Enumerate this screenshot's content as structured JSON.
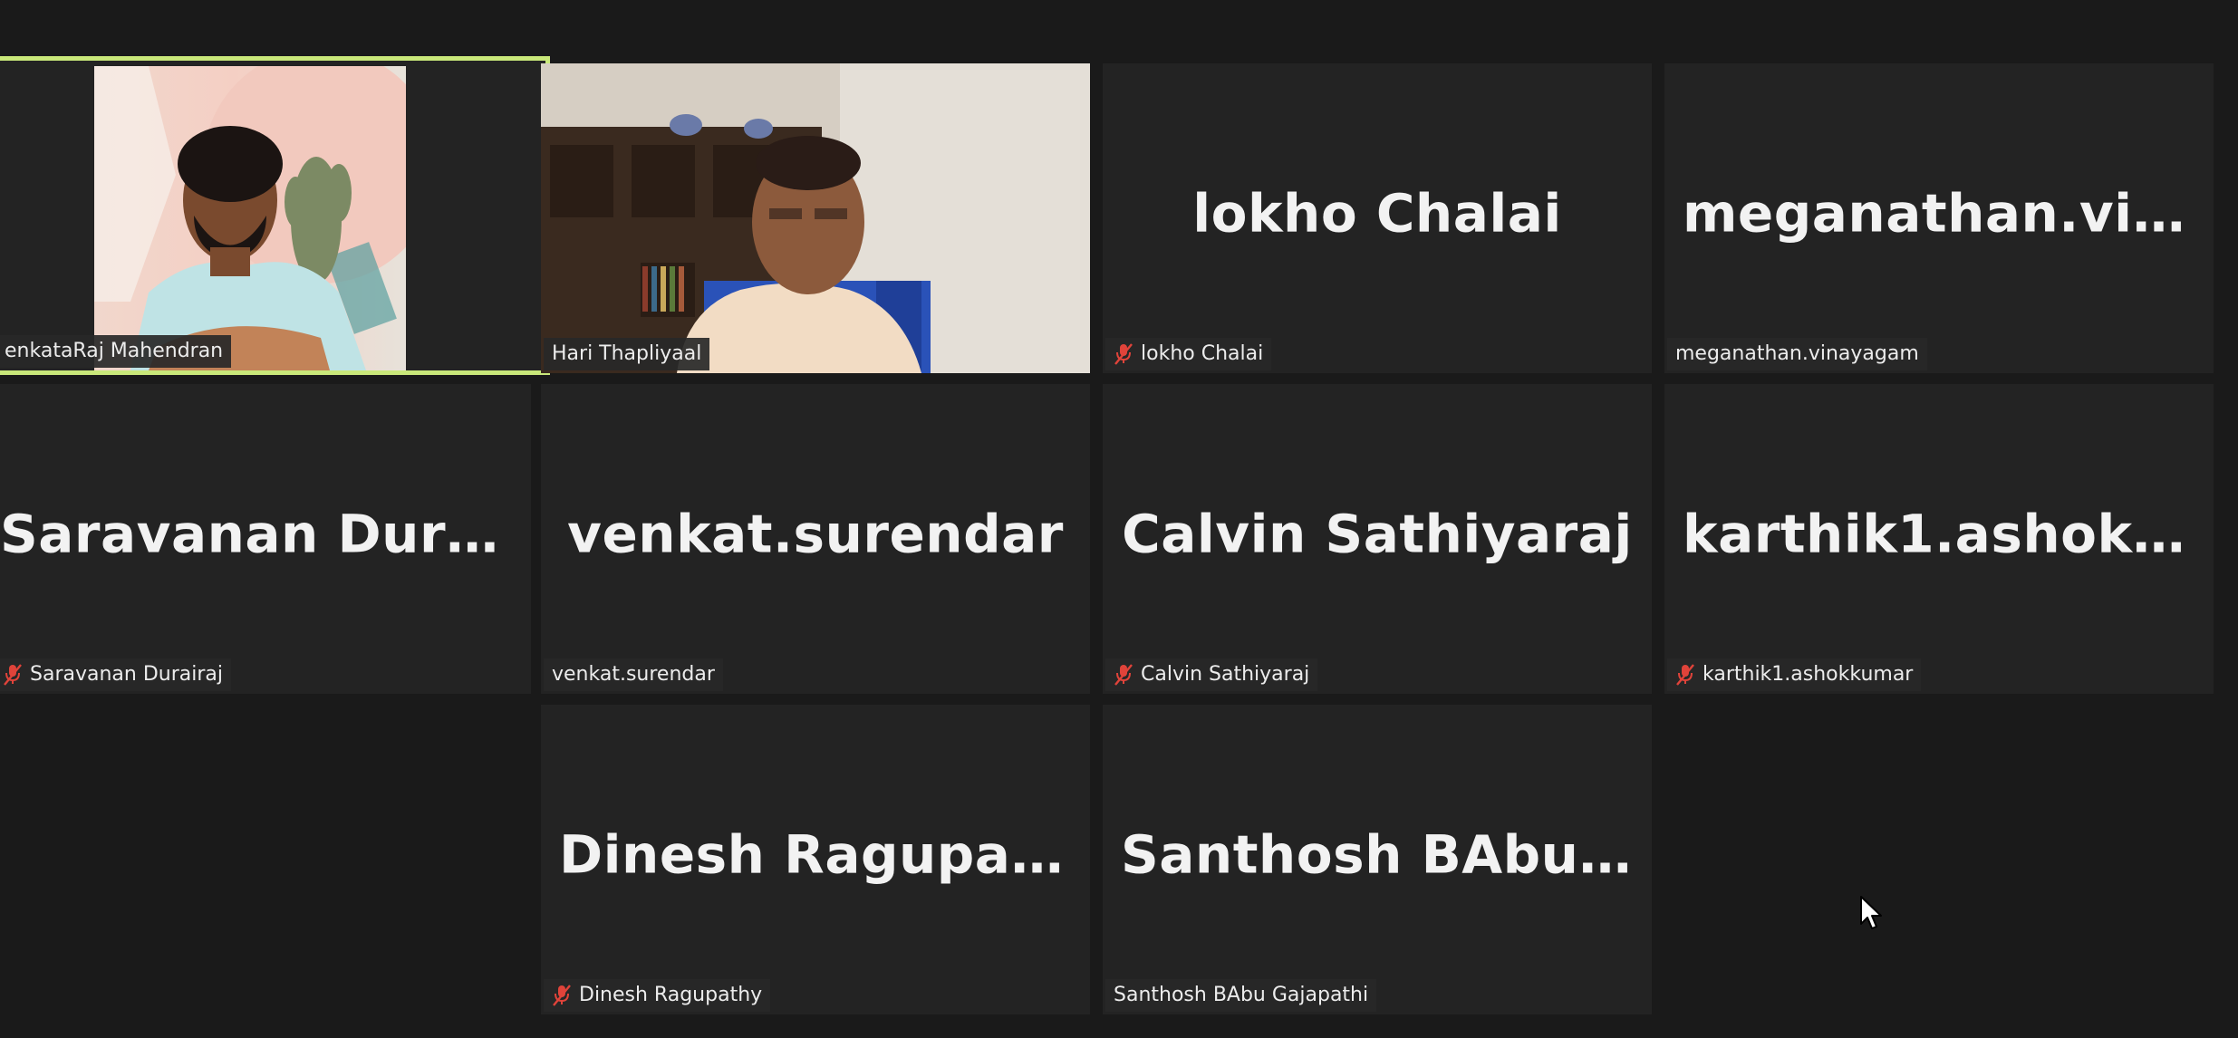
{
  "meeting": {
    "participants": [
      {
        "name": "VenkataRaj Mahendran",
        "label": "enkataRaj Mahendran",
        "video": true,
        "muted": false,
        "active_speaker": true
      },
      {
        "name": "Hari Thapliyaal",
        "label": "Hari Thapliyaal",
        "video": true,
        "muted": false,
        "active_speaker": false
      },
      {
        "name": "lokho Chalai",
        "label": "lokho Chalai",
        "big": "lokho Chalai",
        "video": false,
        "muted": true
      },
      {
        "name": "meganathan.vinayagam",
        "label": "meganathan.vinayagam",
        "big": "meganathan.vin...",
        "video": false,
        "muted": false
      },
      {
        "name": "Saravanan Durairaj",
        "label": "Saravanan Durairaj",
        "big": "Saravanan  Durai...",
        "video": false,
        "muted": true
      },
      {
        "name": "venkat.surendar",
        "label": "venkat.surendar",
        "big": "venkat.surendar",
        "video": false,
        "muted": false
      },
      {
        "name": "Calvin Sathiyaraj",
        "label": "Calvin Sathiyaraj",
        "big": "Calvin Sathiyaraj",
        "video": false,
        "muted": true
      },
      {
        "name": "karthik1.ashokkumar",
        "label": "karthik1.ashokkumar",
        "big": "karthik1.ashokk...",
        "video": false,
        "muted": true
      },
      {
        "name": "Dinesh Ragupathy",
        "label": "Dinesh Ragupathy",
        "big": "Dinesh Ragupathy",
        "video": false,
        "muted": true
      },
      {
        "name": "Santhosh BAbu Gajapathi",
        "label": "Santhosh BAbu Gajapathi",
        "big": "Santhosh  BAbu...",
        "video": false,
        "muted": false
      }
    ]
  },
  "colors": {
    "background": "#1a1a1a",
    "tile": "#232323",
    "active_border": "#c9e87a",
    "mute_red": "#e0433a"
  },
  "icons": {
    "mute": "muted-microphone-icon",
    "cursor": "mouse-pointer-icon"
  }
}
